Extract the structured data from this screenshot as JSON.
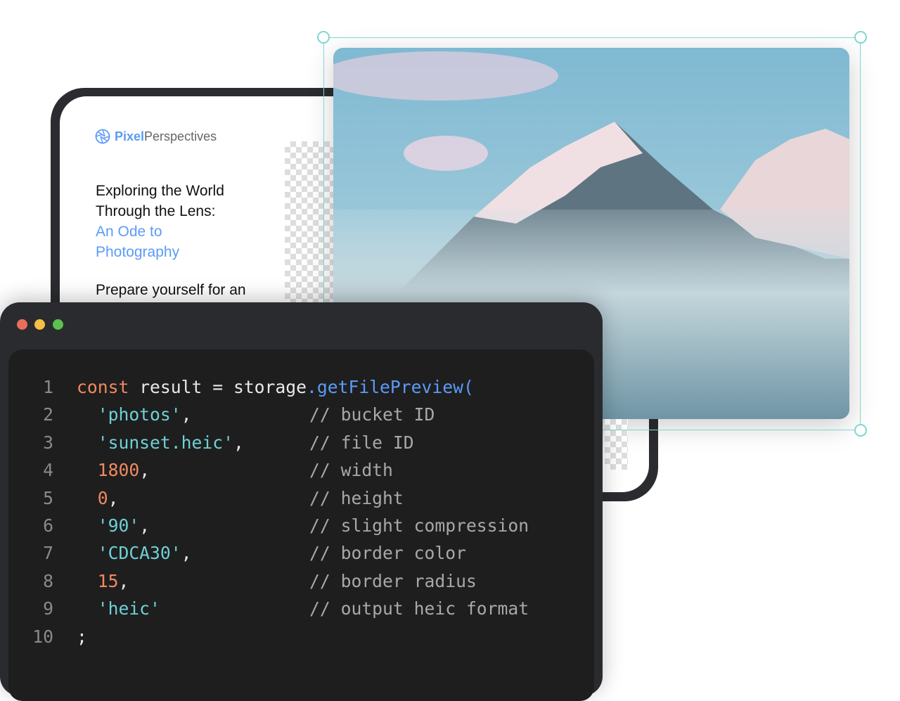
{
  "preview_card": {
    "logo": {
      "bold": "Pixel",
      "rest": "Perspectives"
    },
    "headline": {
      "line1": "Exploring the World Through the Lens:",
      "accent": "An Ode to Photography"
    },
    "body": "Prepare yourself for an exhilarating voyage into"
  },
  "colors": {
    "accent": "#5B9BF5",
    "selection": "#7FD6D0",
    "keyword": "#F08A5D",
    "string": "#6FD0D4"
  },
  "code_window": {
    "lines": [
      {
        "n": "1",
        "parts": [
          {
            "t": "const",
            "c": "kw"
          },
          {
            "t": " result = storage",
            "c": ""
          },
          {
            "t": ".getFilePreview(",
            "c": "fn"
          }
        ],
        "comment": ""
      },
      {
        "n": "2",
        "parts": [
          {
            "t": "  'photos'",
            "c": "str"
          },
          {
            "t": ",",
            "c": ""
          }
        ],
        "comment": "// bucket ID"
      },
      {
        "n": "3",
        "parts": [
          {
            "t": "  'sunset.heic'",
            "c": "str"
          },
          {
            "t": ",",
            "c": ""
          }
        ],
        "comment": "// file ID"
      },
      {
        "n": "4",
        "parts": [
          {
            "t": "  1800",
            "c": "num"
          },
          {
            "t": ",",
            "c": ""
          }
        ],
        "comment": "// width"
      },
      {
        "n": "5",
        "parts": [
          {
            "t": "  0",
            "c": "num"
          },
          {
            "t": ",",
            "c": ""
          }
        ],
        "comment": "// height"
      },
      {
        "n": "6",
        "parts": [
          {
            "t": "  '90'",
            "c": "str"
          },
          {
            "t": ",",
            "c": ""
          }
        ],
        "comment": "// slight compression"
      },
      {
        "n": "7",
        "parts": [
          {
            "t": "  'CDCA30'",
            "c": "str"
          },
          {
            "t": ",",
            "c": ""
          }
        ],
        "comment": "// border color"
      },
      {
        "n": "8",
        "parts": [
          {
            "t": "  15",
            "c": "num"
          },
          {
            "t": ",",
            "c": ""
          }
        ],
        "comment": "// border radius"
      },
      {
        "n": "9",
        "parts": [
          {
            "t": "  'heic'",
            "c": "str"
          }
        ],
        "comment": "// output heic format"
      },
      {
        "n": "10",
        "parts": [
          {
            "t": ";",
            "c": ""
          }
        ],
        "comment": ""
      }
    ]
  }
}
